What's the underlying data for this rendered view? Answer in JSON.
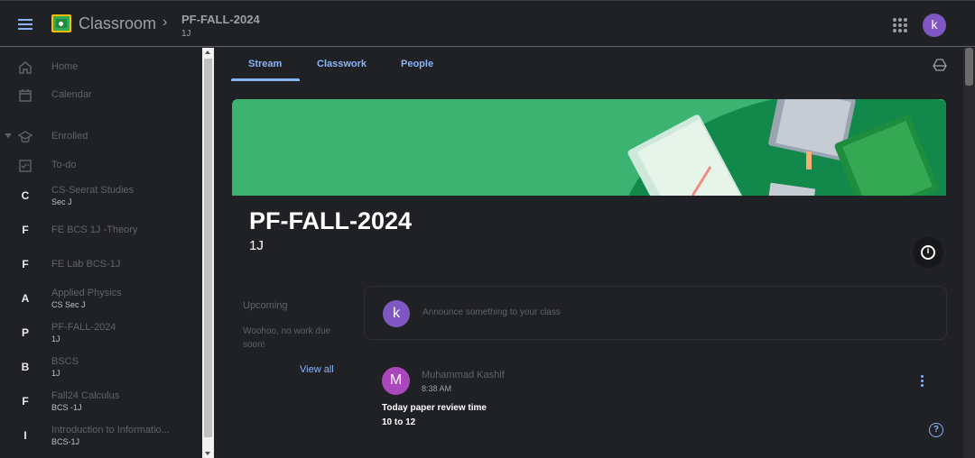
{
  "header": {
    "app_title": "Classroom",
    "breadcrumb_separator": "›",
    "course_title": "PF-FALL-2024",
    "course_section": "1J",
    "user_initial": "k"
  },
  "sidebar": {
    "items": [
      {
        "icon": "home-icon",
        "label": "Home"
      },
      {
        "icon": "calendar-icon",
        "label": "Calendar"
      },
      {
        "icon": "graduation-cap-icon",
        "label": "Enrolled"
      },
      {
        "icon": "todo-icon",
        "label": "To-do"
      }
    ],
    "courses": [
      {
        "letter": "C",
        "name": "CS-Seerat Studies",
        "section": "Sec J"
      },
      {
        "letter": "F",
        "name": "FE BCS 1J -Theory",
        "section": ""
      },
      {
        "letter": "F",
        "name": "FE Lab BCS-1J",
        "section": ""
      },
      {
        "letter": "A",
        "name": "Applied Physics",
        "section": "CS Sec J"
      },
      {
        "letter": "P",
        "name": "PF-FALL-2024",
        "section": "1J"
      },
      {
        "letter": "B",
        "name": "BSCS",
        "section": "1J"
      },
      {
        "letter": "F",
        "name": "Fall24 Calculus",
        "section": "BCS -1J"
      },
      {
        "letter": "I",
        "name": "Introduction to Informatio...",
        "section": "BCS-1J"
      }
    ]
  },
  "tabs": [
    {
      "label": "Stream"
    },
    {
      "label": "Classwork"
    },
    {
      "label": "People"
    }
  ],
  "banner": {
    "title": "PF-FALL-2024",
    "subtitle": "1J",
    "info_glyph": "i"
  },
  "upcoming": {
    "title": "Upcoming",
    "text": "Woohoo, no work due soon!",
    "view_all": "View all"
  },
  "announce": {
    "avatar": "k",
    "placeholder": "Announce something to your class"
  },
  "post": {
    "avatar": "M",
    "author": "Muhammad Kashif",
    "time": "8:38 AM",
    "line1": "Today paper review time",
    "line2": "10 to 12"
  },
  "help_glyph": "?",
  "colors": {
    "accent": "#8ab4f8",
    "banner": "#3cb371",
    "avatar_k": "#7e57c2",
    "avatar_m": "#ab47bc"
  }
}
